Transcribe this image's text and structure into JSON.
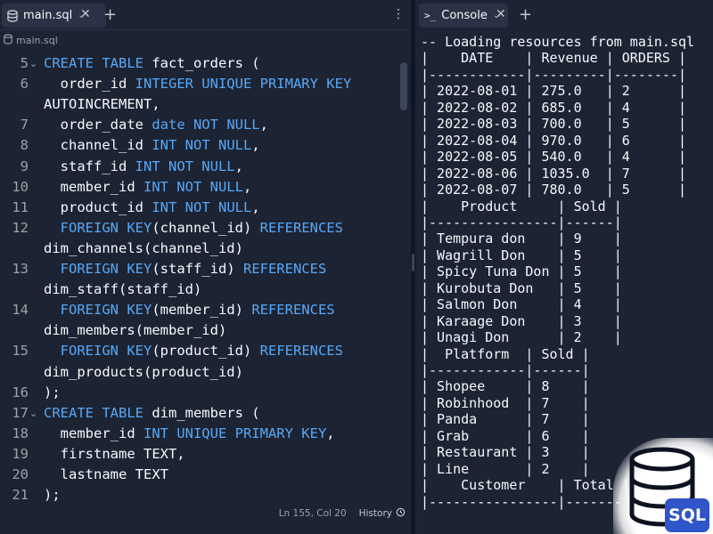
{
  "editor": {
    "tab": {
      "name": "main.sql",
      "icon": "database-icon"
    },
    "breadcrumb": "main.sql",
    "lines": [
      {
        "n": "5",
        "fold": true,
        "segs": [
          [
            "kw",
            "CREATE TABLE"
          ],
          [
            "t",
            " fact_orders ("
          ]
        ]
      },
      {
        "n": "6",
        "fold": false,
        "segs": [
          [
            "t",
            "  order_id "
          ],
          [
            "kw",
            "INTEGER UNIQUE PRIMARY KEY"
          ]
        ]
      },
      {
        "n": "",
        "fold": false,
        "segs": [
          [
            "t",
            "AUTOINCREMENT,"
          ]
        ]
      },
      {
        "n": "7",
        "fold": false,
        "segs": [
          [
            "t",
            "  order_date "
          ],
          [
            "kw",
            "date NOT NULL"
          ],
          [
            "t",
            ","
          ]
        ]
      },
      {
        "n": "8",
        "fold": false,
        "segs": [
          [
            "t",
            "  channel_id "
          ],
          [
            "kw",
            "INT NOT NULL"
          ],
          [
            "t",
            ","
          ]
        ]
      },
      {
        "n": "9",
        "fold": false,
        "segs": [
          [
            "t",
            "  staff_id "
          ],
          [
            "kw",
            "INT NOT NULL"
          ],
          [
            "t",
            ","
          ]
        ]
      },
      {
        "n": "10",
        "fold": false,
        "segs": [
          [
            "t",
            "  member_id "
          ],
          [
            "kw",
            "INT NOT NULL"
          ],
          [
            "t",
            ","
          ]
        ]
      },
      {
        "n": "11",
        "fold": false,
        "segs": [
          [
            "t",
            "  product_id "
          ],
          [
            "kw",
            "INT NOT NULL"
          ],
          [
            "t",
            ","
          ]
        ]
      },
      {
        "n": "12",
        "fold": false,
        "segs": [
          [
            "t",
            "  "
          ],
          [
            "kw",
            "FOREIGN KEY"
          ],
          [
            "t",
            "(channel_id) "
          ],
          [
            "kw",
            "REFERENCES"
          ]
        ]
      },
      {
        "n": "",
        "fold": false,
        "segs": [
          [
            "t",
            "dim_channels(channel_id)"
          ]
        ]
      },
      {
        "n": "13",
        "fold": false,
        "segs": [
          [
            "t",
            "  "
          ],
          [
            "kw",
            "FOREIGN KEY"
          ],
          [
            "t",
            "(staff_id) "
          ],
          [
            "kw",
            "REFERENCES"
          ]
        ]
      },
      {
        "n": "",
        "fold": false,
        "segs": [
          [
            "t",
            "dim_staff(staff_id)"
          ]
        ]
      },
      {
        "n": "14",
        "fold": false,
        "segs": [
          [
            "t",
            "  "
          ],
          [
            "kw",
            "FOREIGN KEY"
          ],
          [
            "t",
            "(member_id) "
          ],
          [
            "kw",
            "REFERENCES"
          ]
        ]
      },
      {
        "n": "",
        "fold": false,
        "segs": [
          [
            "t",
            "dim_members(member_id)"
          ]
        ]
      },
      {
        "n": "15",
        "fold": false,
        "segs": [
          [
            "t",
            "  "
          ],
          [
            "kw",
            "FOREIGN KEY"
          ],
          [
            "t",
            "(product_id) "
          ],
          [
            "kw",
            "REFERENCES"
          ]
        ]
      },
      {
        "n": "",
        "fold": false,
        "segs": [
          [
            "t",
            "dim_products(product_id)"
          ]
        ]
      },
      {
        "n": "16",
        "fold": false,
        "segs": [
          [
            "t",
            ");"
          ]
        ]
      },
      {
        "n": "17",
        "fold": true,
        "segs": [
          [
            "kw",
            "CREATE TABLE"
          ],
          [
            "t",
            " dim_members ("
          ]
        ]
      },
      {
        "n": "18",
        "fold": false,
        "segs": [
          [
            "t",
            "  member_id "
          ],
          [
            "kw",
            "INT UNIQUE PRIMARY KEY"
          ],
          [
            "t",
            ","
          ]
        ]
      },
      {
        "n": "19",
        "fold": false,
        "segs": [
          [
            "t",
            "  firstname TEXT,"
          ]
        ]
      },
      {
        "n": "20",
        "fold": false,
        "segs": [
          [
            "t",
            "  lastname TEXT"
          ]
        ]
      },
      {
        "n": "21",
        "fold": false,
        "segs": [
          [
            "t",
            ");"
          ]
        ]
      }
    ],
    "status": {
      "cursor": "Ln 155, Col 20",
      "history_label": "History"
    }
  },
  "console": {
    "tab": {
      "name": "Console",
      "icon": "terminal-icon"
    },
    "lines": [
      "-- Loading resources from main.sql",
      "|    DATE    | Revenue | ORDERS |",
      "|------------|---------|--------|",
      "| 2022-08-01 | 275.0   | 2      |",
      "| 2022-08-02 | 685.0   | 4      |",
      "| 2022-08-03 | 700.0   | 5      |",
      "| 2022-08-04 | 970.0   | 6      |",
      "| 2022-08-05 | 540.0   | 4      |",
      "| 2022-08-06 | 1035.0  | 7      |",
      "| 2022-08-07 | 780.0   | 5      |",
      "|    Product     | Sold |",
      "|----------------|------|",
      "| Tempura don    | 9    |",
      "| Wagrill Don    | 5    |",
      "| Spicy Tuna Don | 5    |",
      "| Kurobuta Don   | 5    |",
      "| Salmon Don     | 4    |",
      "| Karaage Don    | 3    |",
      "| Unagi Don      | 2    |",
      "|  Platform  | Sold |",
      "|------------|------|",
      "| Shopee     | 8    |",
      "| Robinhood  | 7    |",
      "| Panda      | 7    |",
      "| Grab       | 6    |",
      "| Restaurant | 3    |",
      "| Line       | 2    |",
      "|    Customer    | Total |",
      "|----------------|-------"
    ]
  },
  "logo": {
    "badge_text": "SQL",
    "icon": "database-icon"
  },
  "colors": {
    "background": "#1c2333",
    "keyword": "#56a8f5",
    "text": "#f5f9fc",
    "muted": "#9da2a6",
    "badge": "#2f55c9"
  }
}
